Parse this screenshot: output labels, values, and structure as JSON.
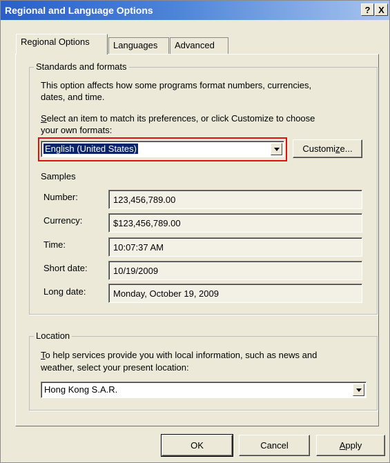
{
  "window": {
    "title": "Regional and Language Options",
    "help_button": "?",
    "close_button": "X"
  },
  "tabs": [
    {
      "label": "Regional Options",
      "active": true
    },
    {
      "label": "Languages",
      "active": false
    },
    {
      "label": "Advanced",
      "active": false
    }
  ],
  "standards": {
    "legend": "Standards and formats",
    "description_line1": "This option affects how some programs format numbers, currencies,",
    "description_line2": "dates, and time.",
    "select_prompt_line1_key": "S",
    "select_prompt_line1_rest": "elect an item to match its preferences, or click Customize to choose",
    "select_prompt_line2": "your own formats:",
    "format_value": "English (United States)",
    "customize_label_pre": "Customi",
    "customize_label_key": "z",
    "customize_label_post": "e...",
    "highlight_color": "#e01010"
  },
  "samples": {
    "heading": "Samples",
    "rows": [
      {
        "label": "Number:",
        "value": "123,456,789.00"
      },
      {
        "label": "Currency:",
        "value": "$123,456,789.00"
      },
      {
        "label": "Time:",
        "value": "10:07:37 AM"
      },
      {
        "label": "Short date:",
        "value": "10/19/2009"
      },
      {
        "label": "Long date:",
        "value": "Monday, October 19, 2009"
      }
    ]
  },
  "location": {
    "legend": "Location",
    "description_line1_key": "T",
    "description_line1_rest": "o help services provide you with local information, such as news and",
    "description_line2": "weather, select your present location:",
    "value": "Hong Kong S.A.R."
  },
  "buttons": {
    "ok": "OK",
    "cancel": "Cancel",
    "apply_key": "A",
    "apply_rest": "pply"
  },
  "colors": {
    "titlebar_start": "#2a5fc9",
    "dialog_face": "#ece9d8",
    "selection": "#0a246a"
  }
}
